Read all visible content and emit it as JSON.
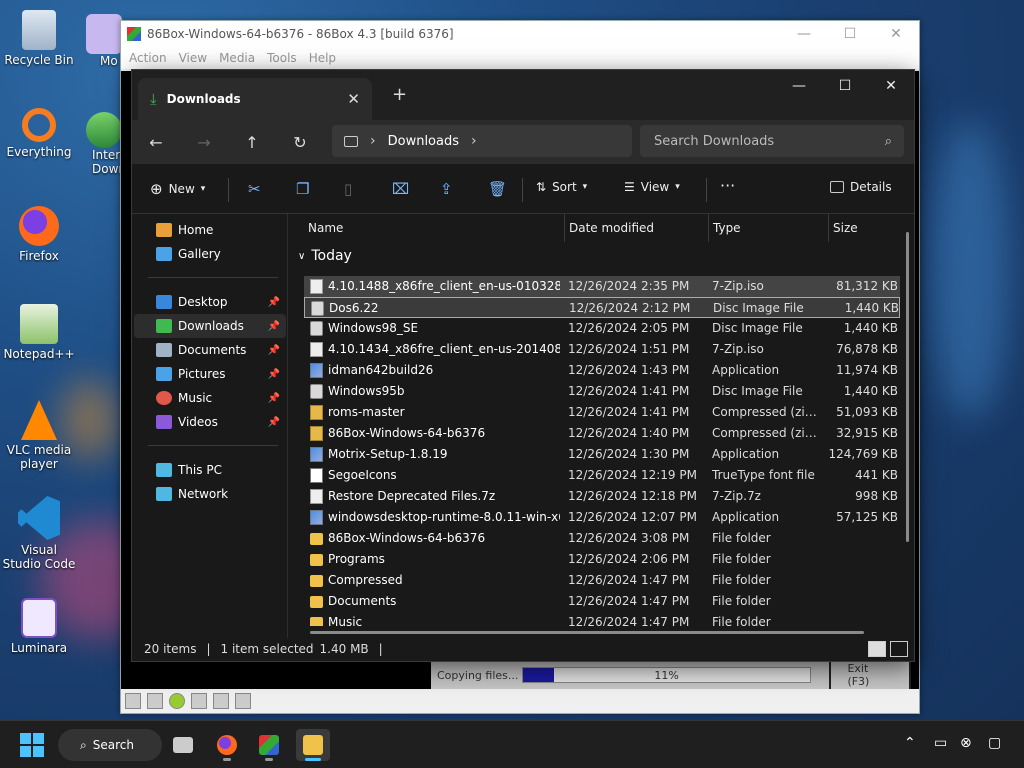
{
  "desktop": {
    "icons": [
      {
        "label": "Recycle Bin"
      },
      {
        "label": "Everything"
      },
      {
        "label": "Firefox"
      },
      {
        "label": "Notepad++"
      },
      {
        "label": "VLC media player"
      },
      {
        "label": "Visual Studio Code"
      },
      {
        "label": "Luminara"
      }
    ],
    "partial_labels": {
      "mo": "Mo",
      "inter": "Inter Down"
    }
  },
  "box86": {
    "title": "86Box-Windows-64-b6376 - 86Box 4.3 [build 6376]",
    "menu": [
      "Action",
      "View",
      "Media",
      "Tools",
      "Help"
    ],
    "dos": {
      "copying": "Copying files...",
      "percent": "11%",
      "progress": 0.11,
      "exit": "Exit (F3)"
    }
  },
  "explorer": {
    "tab_label": "Downloads",
    "address": {
      "crumb": "Downloads"
    },
    "search_placeholder": "Search Downloads",
    "toolbar": {
      "new": "New",
      "sort": "Sort",
      "view": "View",
      "details": "Details",
      "more": "···"
    },
    "sidebar": {
      "top": [
        {
          "label": "Home"
        },
        {
          "label": "Gallery"
        }
      ],
      "pinned": [
        {
          "label": "Desktop"
        },
        {
          "label": "Downloads"
        },
        {
          "label": "Documents"
        },
        {
          "label": "Pictures"
        },
        {
          "label": "Music"
        },
        {
          "label": "Videos"
        }
      ],
      "bottom": [
        {
          "label": "This PC"
        },
        {
          "label": "Network"
        }
      ]
    },
    "columns": {
      "name": "Name",
      "date": "Date modified",
      "type": "Type",
      "size": "Size"
    },
    "group": "Today",
    "files": [
      {
        "name": "4.10.1488_x86fre_client_en-us-010328_014...",
        "date": "12/26/2024 2:35 PM",
        "type": "7-Zip.iso",
        "size": "81,312 KB",
        "icon": "file-icon"
      },
      {
        "name": "Dos6.22",
        "date": "12/26/2024 2:12 PM",
        "type": "Disc Image File",
        "size": "1,440 KB",
        "icon": "disc-image-icon"
      },
      {
        "name": "Windows98_SE",
        "date": "12/26/2024 2:05 PM",
        "type": "Disc Image File",
        "size": "1,440 KB",
        "icon": "disc-image-icon"
      },
      {
        "name": "4.10.1434_x86fre_client_en-us-20140826_2...",
        "date": "12/26/2024 1:51 PM",
        "type": "7-Zip.iso",
        "size": "76,878 KB",
        "icon": "file-icon"
      },
      {
        "name": "idman642build26",
        "date": "12/26/2024 1:43 PM",
        "type": "Application",
        "size": "11,974 KB",
        "icon": "application-icon"
      },
      {
        "name": "Windows95b",
        "date": "12/26/2024 1:41 PM",
        "type": "Disc Image File",
        "size": "1,440 KB",
        "icon": "disc-image-icon"
      },
      {
        "name": "roms-master",
        "date": "12/26/2024 1:41 PM",
        "type": "Compressed (zipp...",
        "size": "51,093 KB",
        "icon": "zip-folder-icon"
      },
      {
        "name": "86Box-Windows-64-b6376",
        "date": "12/26/2024 1:40 PM",
        "type": "Compressed (zipp...",
        "size": "32,915 KB",
        "icon": "zip-folder-icon"
      },
      {
        "name": "Motrix-Setup-1.8.19",
        "date": "12/26/2024 1:30 PM",
        "type": "Application",
        "size": "124,769 KB",
        "icon": "application-icon"
      },
      {
        "name": "SegoeIcons",
        "date": "12/26/2024 12:19 PM",
        "type": "TrueType font file",
        "size": "441 KB",
        "icon": "font-file-icon"
      },
      {
        "name": "Restore Deprecated Files.7z",
        "date": "12/26/2024 12:18 PM",
        "type": "7-Zip.7z",
        "size": "998 KB",
        "icon": "file-icon"
      },
      {
        "name": "windowsdesktop-runtime-8.0.11-win-x64",
        "date": "12/26/2024 12:07 PM",
        "type": "Application",
        "size": "57,125 KB",
        "icon": "application-icon"
      },
      {
        "name": "86Box-Windows-64-b6376",
        "date": "12/26/2024 3:08 PM",
        "type": "File folder",
        "size": "",
        "icon": "folder-icon"
      },
      {
        "name": "Programs",
        "date": "12/26/2024 2:06 PM",
        "type": "File folder",
        "size": "",
        "icon": "folder-icon"
      },
      {
        "name": "Compressed",
        "date": "12/26/2024 1:47 PM",
        "type": "File folder",
        "size": "",
        "icon": "folder-icon"
      },
      {
        "name": "Documents",
        "date": "12/26/2024 1:47 PM",
        "type": "File folder",
        "size": "",
        "icon": "folder-icon"
      },
      {
        "name": "Music",
        "date": "12/26/2024 1:47 PM",
        "type": "File folder",
        "size": "",
        "icon": "folder-icon"
      }
    ],
    "status": {
      "items": "20 items",
      "selected": "1 item selected",
      "size": "1.40 MB"
    }
  },
  "taskbar": {
    "search_label": "Search"
  },
  "colors": {
    "accent": "#4cc2ff",
    "explorer_bg": "#191919",
    "folder": "#f1c24a"
  }
}
